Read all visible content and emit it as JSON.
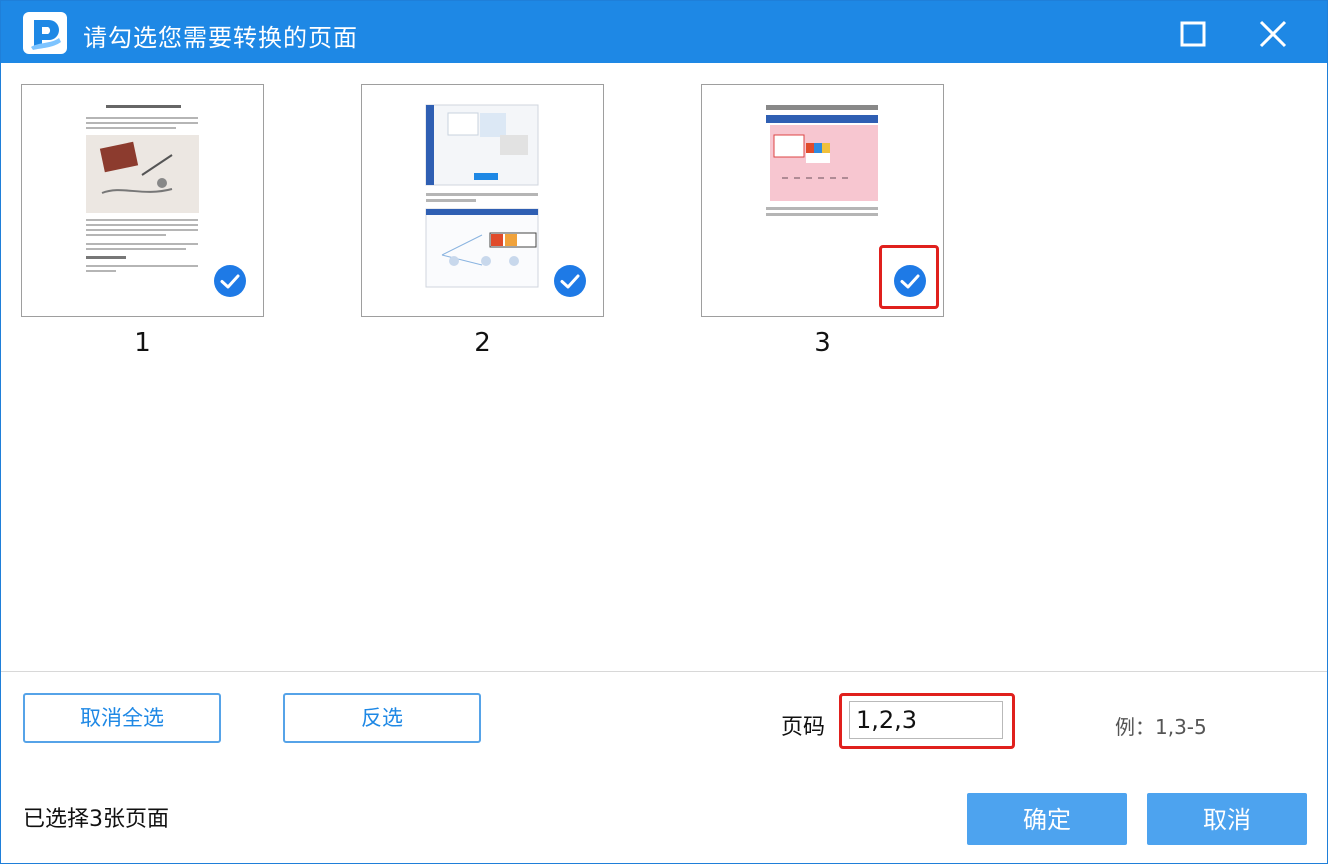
{
  "window": {
    "title": "请勾选您需要转换的页面",
    "logo_icon": "pdf-converter-logo",
    "accent_color": "#1e88e5"
  },
  "pages": [
    {
      "number": "1",
      "checked": true
    },
    {
      "number": "2",
      "checked": true
    },
    {
      "number": "3",
      "checked": true
    }
  ],
  "footer": {
    "deselect_all_label": "取消全选",
    "invert_label": "反选",
    "page_label": "页码",
    "page_value": "1,2,3",
    "example": "例：1,3-5",
    "status": "已选择3张页面",
    "ok_label": "确定",
    "cancel_label": "取消"
  },
  "highlight_color": "#e0201d"
}
